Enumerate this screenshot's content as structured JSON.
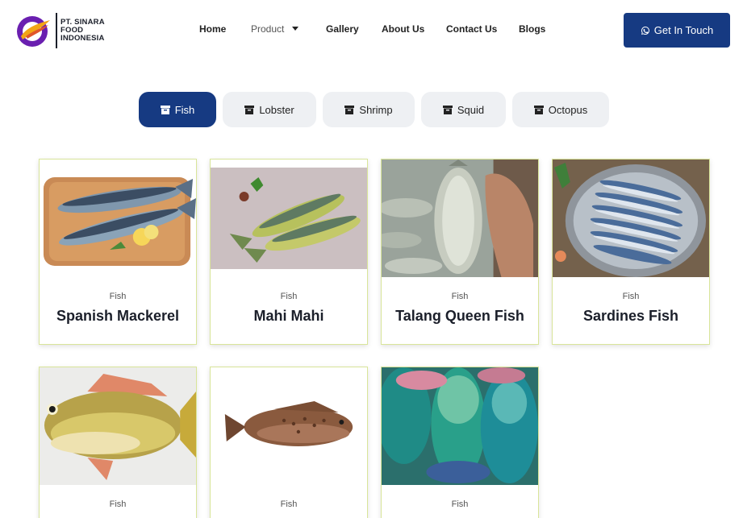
{
  "header": {
    "logo_lines": [
      "PT. SINARA",
      "FOOD",
      "INDONESIA"
    ],
    "nav": [
      {
        "label": "Home"
      },
      {
        "label": "Product"
      },
      {
        "label": "Gallery"
      },
      {
        "label": "About Us"
      },
      {
        "label": "Contact Us"
      },
      {
        "label": "Blogs"
      }
    ],
    "cta_label": "Get In Touch",
    "cta_icon": "whatsapp-icon"
  },
  "colors": {
    "brand": "#163a82",
    "tab_bg": "#eef0f3",
    "card_border": "#d9e59a"
  },
  "tabs": [
    {
      "label": "Fish",
      "active": true,
      "icon": "box-icon"
    },
    {
      "label": "Lobster",
      "active": false,
      "icon": "box-icon"
    },
    {
      "label": "Shrimp",
      "active": false,
      "icon": "box-icon"
    },
    {
      "label": "Squid",
      "active": false,
      "icon": "box-icon"
    },
    {
      "label": "Octopus",
      "active": false,
      "icon": "box-icon"
    }
  ],
  "products": [
    {
      "category": "Fish",
      "name": "Spanish Mackerel"
    },
    {
      "category": "Fish",
      "name": "Mahi Mahi"
    },
    {
      "category": "Fish",
      "name": "Talang Queen Fish"
    },
    {
      "category": "Fish",
      "name": "Sardines Fish"
    },
    {
      "category": "Fish",
      "name": ""
    },
    {
      "category": "Fish",
      "name": ""
    },
    {
      "category": "Fish",
      "name": ""
    }
  ]
}
